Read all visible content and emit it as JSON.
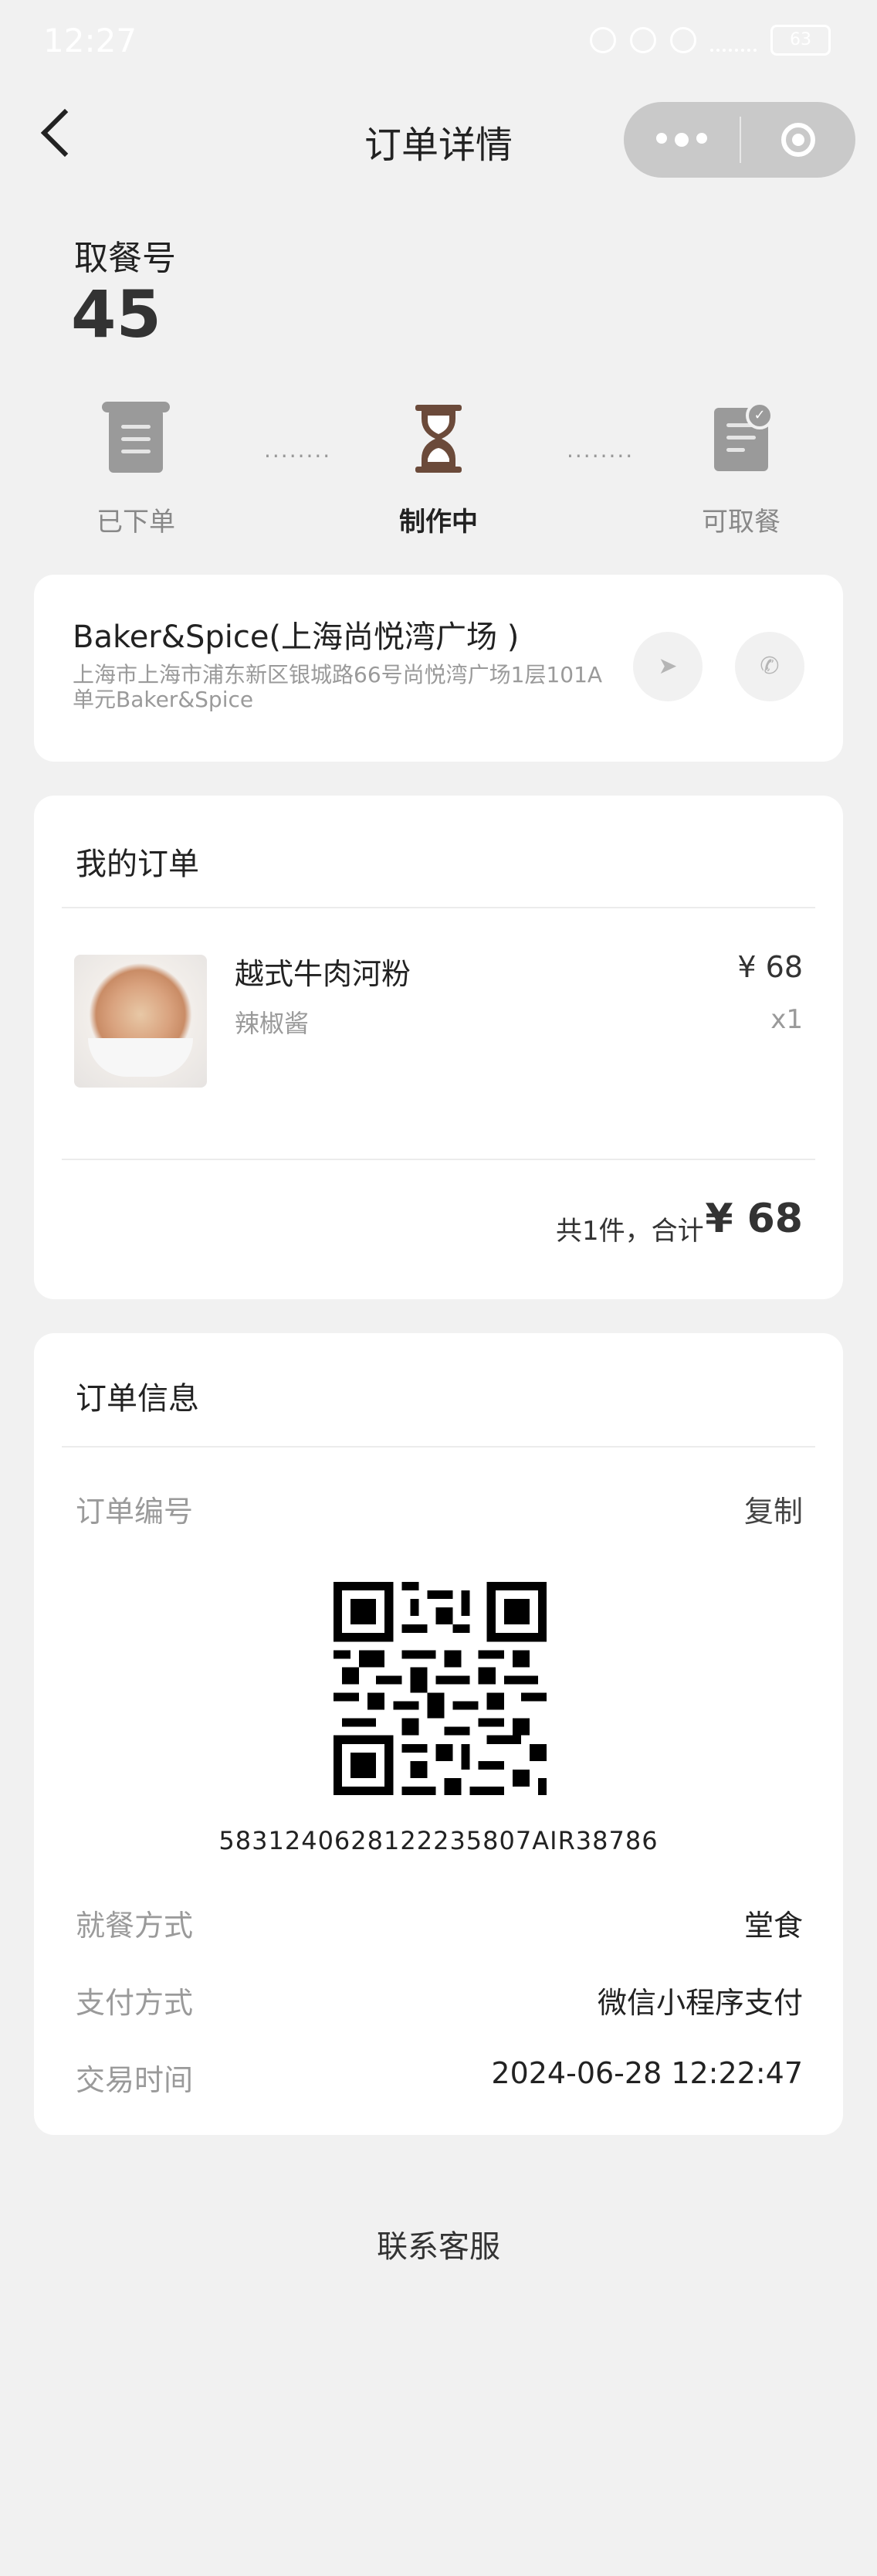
{
  "status_bar": {
    "time": "12:27",
    "battery": "63"
  },
  "nav": {
    "title": "订单详情"
  },
  "pickup": {
    "label": "取餐号",
    "number": "45"
  },
  "steps": [
    {
      "label": "已下单",
      "icon": "receipt-icon",
      "active": false
    },
    {
      "label": "制作中",
      "icon": "hourglass-icon",
      "active": true
    },
    {
      "label": "可取餐",
      "icon": "ready-document-icon",
      "active": false
    }
  ],
  "store": {
    "name": "Baker&Spice(上海尚悦湾广场 )",
    "address": "上海市上海市浦东新区银城路66号尚悦湾广场1层101A单元Baker&Spice"
  },
  "my_order": {
    "title": "我的订单",
    "item": {
      "name": "越式牛肉河粉",
      "option": "辣椒酱",
      "price": "¥ 68",
      "qty": "x1"
    },
    "total_label": "共1件，合计",
    "total_value": "¥ 68"
  },
  "order_info": {
    "title": "订单信息",
    "order_no_label": "订单编号",
    "copy_label": "复制",
    "order_no": "5831240628122235807AIR38786",
    "rows": [
      {
        "label": "就餐方式",
        "value": "堂食"
      },
      {
        "label": "支付方式",
        "value": "微信小程序支付"
      },
      {
        "label": "交易时间",
        "value": "2024-06-28 12:22:47"
      }
    ]
  },
  "footer": {
    "service": "联系客服"
  }
}
